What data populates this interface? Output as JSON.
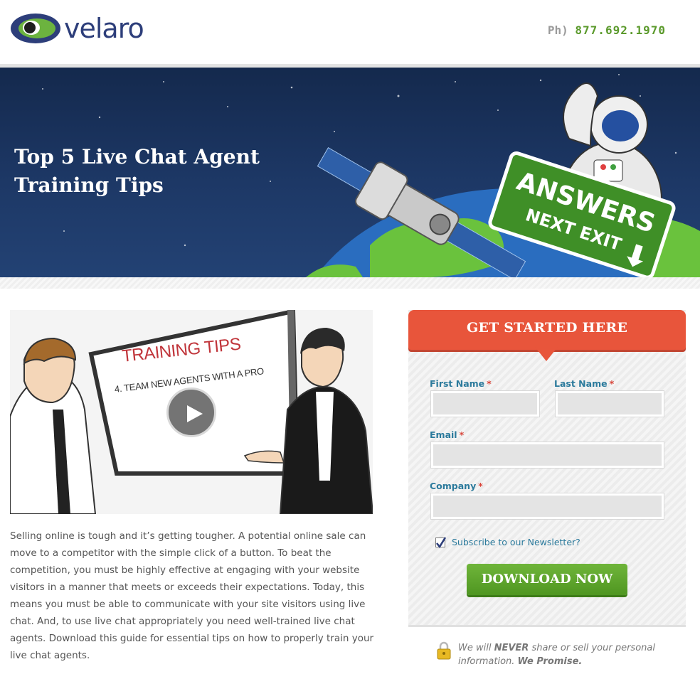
{
  "header": {
    "logo_text": "velaro",
    "phone_label": "Ph)",
    "phone_number": "877.692.1970"
  },
  "hero": {
    "title": "Top 5 Live Chat Agent Training Tips",
    "sign_line1": "ANSWERS",
    "sign_line2": "NEXT EXIT"
  },
  "video": {
    "board_title": "TRAINING TIPS",
    "board_subtitle": "4. TEAM NEW AGENTS WITH A PRO"
  },
  "body_copy": "Selling online is tough and it’s getting tougher. A potential online sale can move to a competitor with the simple click of a button. To beat the competition, you must be highly effective at engaging with your website visitors in a manner that meets or exceeds their expectations. Today, this means you must be able to communicate with your site visitors using live chat. And, to use live chat appropriately you need well-trained live chat agents. Download this guide for essential tips on how to properly train your live chat agents.",
  "form": {
    "banner": "GET STARTED HERE",
    "first_name_label": "First Name",
    "last_name_label": "Last Name",
    "email_label": "Email",
    "company_label": "Company",
    "required_mark": "*",
    "first_name_value": "",
    "last_name_value": "",
    "email_value": "",
    "company_value": "",
    "subscribe_label": "Subscribe to our Newsletter?",
    "subscribe_checked": true,
    "download_label": "DOWNLOAD NOW"
  },
  "privacy": {
    "prefix": "We will",
    "never": "NEVER",
    "middle": "share or sell your personal information.",
    "promise": "We Promise."
  },
  "colors": {
    "brand_blue": "#2d3e7a",
    "brand_green": "#5b9a2c",
    "banner_orange": "#e8553b",
    "label_teal": "#2b7a9c",
    "button_green": "#5aa52b"
  }
}
